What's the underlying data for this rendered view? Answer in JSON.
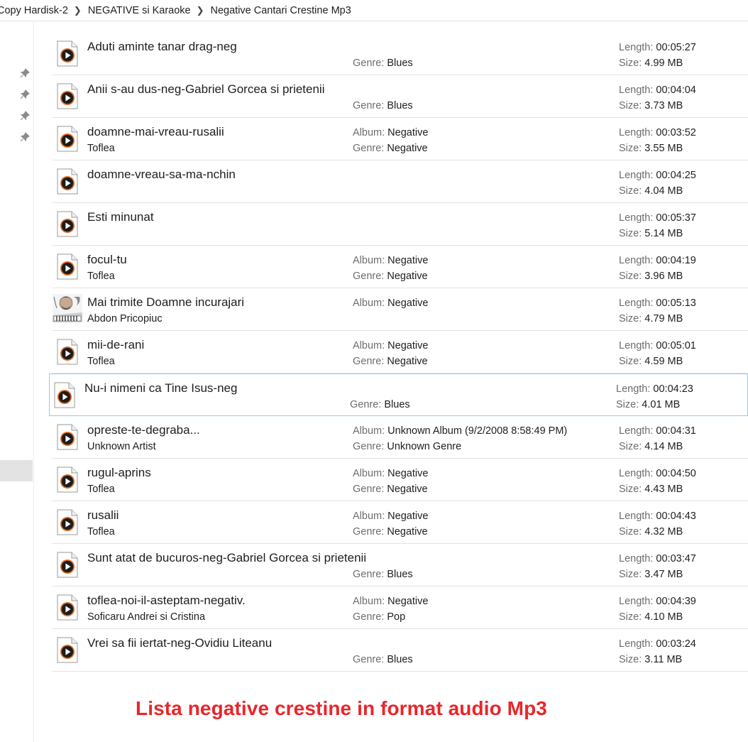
{
  "breadcrumb": [
    "Copy Hardisk-2",
    "NEGATIVE si Karaoke",
    "Negative Cantari Crestine Mp3"
  ],
  "labels": {
    "album": "Album:",
    "genre": "Genre:",
    "length": "Length:",
    "size": "Size:"
  },
  "icons": {
    "pin": "pin-icon",
    "breadcrumb_separator": "chevron-right-icon",
    "file": "audio-file-icon",
    "thumbnail": "album-art-thumbnail"
  },
  "colors": {
    "caption": "#e8262b",
    "focus_border": "#99c9ea",
    "label": "#6d6d6d"
  },
  "files": [
    {
      "name": "Aduti aminte tanar drag-neg",
      "artist": "",
      "album": "",
      "genre": "Blues",
      "length": "00:05:27",
      "size": "4.99 MB"
    },
    {
      "name": "Anii s-au dus-neg-Gabriel Gorcea si prietenii",
      "artist": "",
      "album": "",
      "genre": "Blues",
      "length": "00:04:04",
      "size": "3.73 MB"
    },
    {
      "name": "doamne-mai-vreau-rusalii",
      "artist": "Toflea",
      "album": "Negative",
      "genre": "Negative",
      "length": "00:03:52",
      "size": "3.55 MB"
    },
    {
      "name": "doamne-vreau-sa-ma-nchin",
      "artist": "",
      "album": "",
      "genre": "",
      "length": "00:04:25",
      "size": "4.04 MB"
    },
    {
      "name": "Esti  minunat",
      "artist": "",
      "album": "",
      "genre": "",
      "length": "00:05:37",
      "size": "5.14 MB"
    },
    {
      "name": "focul-tu",
      "artist": "Toflea",
      "album": "Negative",
      "genre": "Negative",
      "length": "00:04:19",
      "size": "3.96 MB"
    },
    {
      "name": "Mai trimite Doamne incurajari",
      "artist": "Abdon Pricopiuc",
      "album": "Negative",
      "genre": "",
      "length": "00:05:13",
      "size": "4.79 MB",
      "thumbnail": true
    },
    {
      "name": "mii-de-rani",
      "artist": "Toflea",
      "album": "Negative",
      "genre": "Negative",
      "length": "00:05:01",
      "size": "4.59 MB"
    },
    {
      "name": "Nu-i nimeni ca Tine Isus-neg",
      "artist": "",
      "album": "",
      "genre": "Blues",
      "length": "00:04:23",
      "size": "4.01 MB",
      "focused": true
    },
    {
      "name": "opreste-te-degraba...",
      "artist": "Unknown Artist",
      "album": "Unknown Album (9/2/2008 8:58:49 PM)",
      "genre": "Unknown Genre",
      "length": "00:04:31",
      "size": "4.14 MB"
    },
    {
      "name": "rugul-aprins",
      "artist": "Toflea",
      "album": "Negative",
      "genre": "Negative",
      "length": "00:04:50",
      "size": "4.43 MB"
    },
    {
      "name": "rusalii",
      "artist": "Toflea",
      "album": "Negative",
      "genre": "Negative",
      "length": "00:04:43",
      "size": "4.32 MB"
    },
    {
      "name": "Sunt atat de bucuros-neg-Gabriel Gorcea si prietenii",
      "artist": "",
      "album": "",
      "genre": "Blues",
      "length": "00:03:47",
      "size": "3.47 MB"
    },
    {
      "name": "toflea-noi-il-asteptam-negativ.",
      "artist": "Soficaru Andrei si Cristina",
      "album": "Negative",
      "genre": "Pop",
      "length": "00:04:39",
      "size": "4.10 MB"
    },
    {
      "name": "Vrei sa fii iertat-neg-Ovidiu Liteanu",
      "artist": "",
      "album": "",
      "genre": "Blues",
      "length": "00:03:24",
      "size": "3.11 MB"
    }
  ],
  "caption": "Lista negative crestine in format audio Mp3"
}
